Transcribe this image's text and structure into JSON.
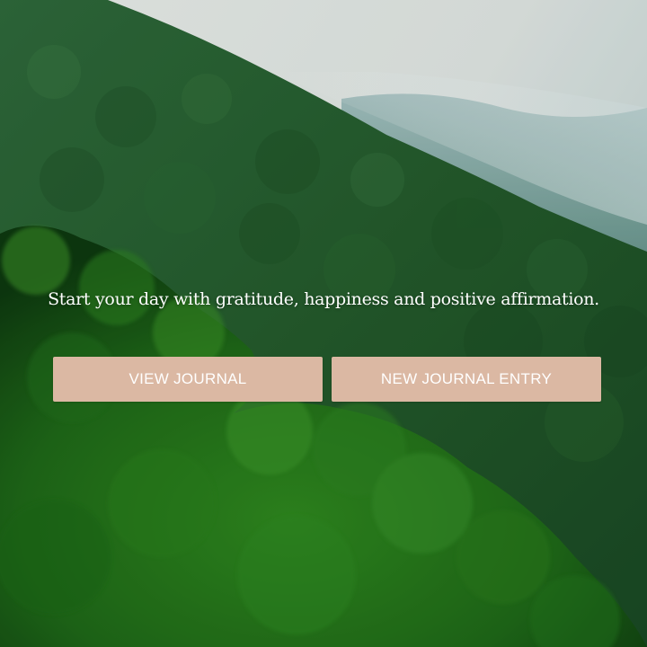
{
  "hero": {
    "background": "forested-mountain-photo",
    "tagline": "Start your day with gratitude, happiness and positive affirmation."
  },
  "actions": {
    "view_journal_label": "VIEW JOURNAL",
    "new_entry_label": "NEW JOURNAL ENTRY",
    "button_color": "#dbb8a3"
  }
}
